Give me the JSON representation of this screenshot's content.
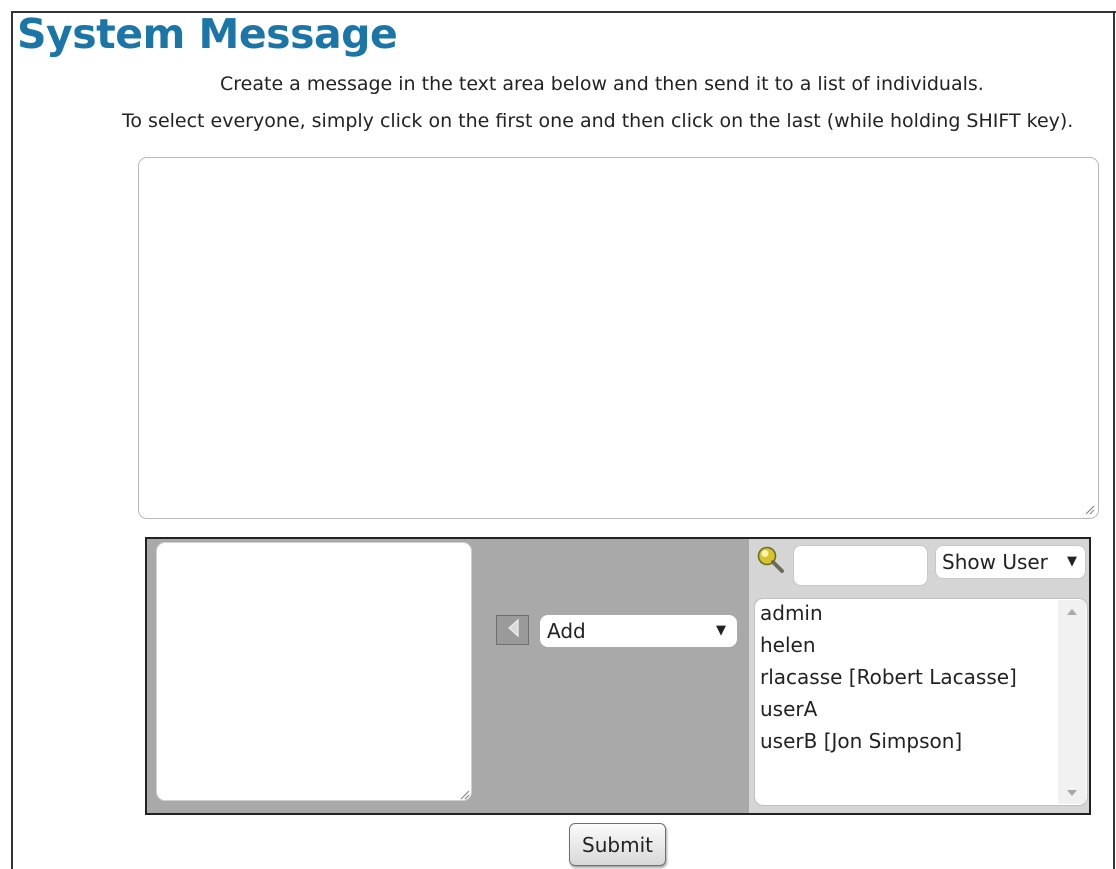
{
  "page": {
    "title": "System Message",
    "instruction_line_1": "Create a message in the text area below and then send it to a list of individuals.",
    "instruction_line_2": "To select everyone, simply click on the first one and then click on the last (while holding SHIFT key).",
    "accent_color": "#1b75a7"
  },
  "message": {
    "value": "",
    "placeholder": ""
  },
  "recipients": {
    "selected": []
  },
  "transfer": {
    "arrow_icon": "left-arrow-icon",
    "action_select": {
      "selected": "Add"
    }
  },
  "user_picker": {
    "search_icon": "magnifier-icon",
    "search": {
      "value": "",
      "placeholder": ""
    },
    "filter_select": {
      "selected": "Show User"
    },
    "users": [
      "admin",
      "helen",
      "rlacasse [Robert Lacasse]",
      "userA",
      "userB [Jon Simpson]"
    ]
  },
  "submit_label": "Submit"
}
